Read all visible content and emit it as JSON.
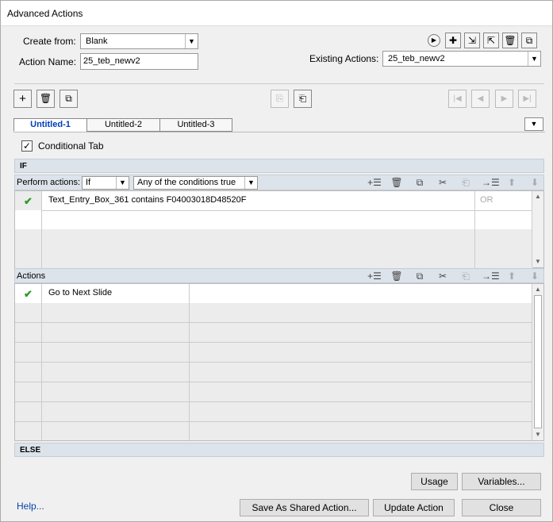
{
  "window": {
    "title": "Advanced Actions"
  },
  "form": {
    "create_from_label": "Create from:",
    "create_from_value": "Blank",
    "action_name_label": "Action Name:",
    "action_name_value": "25_teb_newv2",
    "existing_actions_label": "Existing Actions:",
    "existing_actions_value": "25_teb_newv2"
  },
  "tabs": [
    {
      "label": "Untitled-1",
      "active": true
    },
    {
      "label": "Untitled-2",
      "active": false
    },
    {
      "label": "Untitled-3",
      "active": false
    }
  ],
  "conditional": {
    "label": "Conditional Tab",
    "checked": true
  },
  "if_section": {
    "header": "IF",
    "perform_actions_label": "Perform actions:",
    "perform_value": "If",
    "condition_mode_value": "Any of the conditions true",
    "rows": [
      {
        "status": "✔",
        "text": "Text_Entry_Box_361   contains   F04003018D48520F",
        "op": "OR"
      },
      {
        "status": "",
        "text": "",
        "op": ""
      },
      {
        "status": "",
        "text": "",
        "op": ""
      },
      {
        "status": "",
        "text": "",
        "op": ""
      }
    ]
  },
  "actions_section": {
    "header": "Actions",
    "rows": [
      {
        "status": "✔",
        "text": "Go to Next Slide"
      },
      {
        "status": "",
        "text": ""
      },
      {
        "status": "",
        "text": ""
      },
      {
        "status": "",
        "text": ""
      },
      {
        "status": "",
        "text": ""
      },
      {
        "status": "",
        "text": ""
      },
      {
        "status": "",
        "text": ""
      },
      {
        "status": "",
        "text": ""
      }
    ]
  },
  "else_section": {
    "header": "ELSE"
  },
  "buttons": {
    "usage": "Usage",
    "variables": "Variables...",
    "help": "Help...",
    "save_shared": "Save As Shared Action...",
    "update": "Update Action",
    "close": "Close"
  },
  "colors": {
    "accent": "#003cbf",
    "check": "#2a9d2a",
    "panel": "#dde3ea"
  }
}
